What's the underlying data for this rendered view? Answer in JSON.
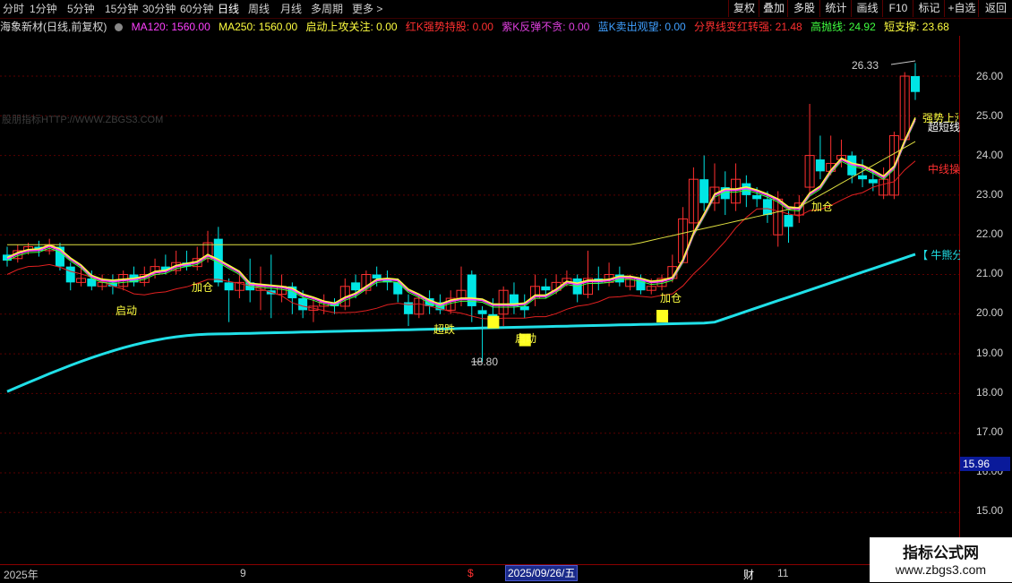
{
  "toolbar": {
    "periods": [
      "分时",
      "1分钟",
      "5分钟",
      "15分钟",
      "30分钟",
      "60分钟",
      "日线",
      "周线",
      "月线",
      "多周期",
      "更多 >"
    ],
    "active_period": "日线",
    "right_buttons": [
      "复权",
      "叠加",
      "多股",
      "统计",
      "画线",
      "F10",
      "标记",
      "+自选",
      "返回"
    ]
  },
  "indicators": {
    "title": "海象新材(日线,前复权)",
    "ma120": "MA120: 1560.00",
    "ma250": "MA250: 1560.00",
    "launch": "启动上攻关注: 0.00",
    "red_k": "红K强势持股: 0.00",
    "purple_k": "紫K反弹不贪: 0.00",
    "blue_k": "蓝K卖出观望: 0.00",
    "boundary": "分界线变红转强: 21.48",
    "high_line": "高抛线: 24.92",
    "short_support": "短支撑: 23.68",
    "colors": {
      "ma120": "#ff40ff",
      "ma250": "#ffff40",
      "launch": "#ffff40",
      "red_k": "#ff3030",
      "purple_k": "#e040e0",
      "blue_k": "#40a0ff",
      "boundary": "#ff3030",
      "high_line": "#40ff40",
      "short_support": "#ffff40"
    }
  },
  "watermark": "股朋指标HTTP://WWW.ZBGS3.COM",
  "axis": {
    "ticks": [
      "26.00",
      "25.00",
      "24.00",
      "23.00",
      "22.00",
      "21.00",
      "20.00",
      "19.00",
      "18.00",
      "17.00",
      "16.00",
      "15.00"
    ],
    "current_price": "15.96"
  },
  "annotations": {
    "high": "26.33",
    "low": "18.80",
    "qidong": "启动",
    "jiacang": "加仓",
    "chaodi": "超跌",
    "strong_up": "强势上涨",
    "short_line": "超短线",
    "mid_line": "中线操",
    "boundary_label": "【 牛熊分界"
  },
  "dates": {
    "year": "2025年",
    "m9": "9",
    "cursor": "2025/09/26/五",
    "m11": "11",
    "s_mark": "$",
    "cai_mark": "财"
  },
  "logo": {
    "line1": "指标公式网",
    "line2": "www.zbgs3.com"
  },
  "chart_data": {
    "type": "candlestick",
    "ylim": [
      14.6,
      26.9
    ],
    "candles": [
      [
        21.5,
        21.35,
        21.7,
        21.2
      ],
      [
        21.4,
        21.6,
        21.75,
        21.3
      ],
      [
        21.6,
        21.7,
        21.8,
        21.5
      ],
      [
        21.7,
        21.6,
        21.85,
        21.45
      ],
      [
        21.6,
        21.75,
        21.9,
        21.5
      ],
      [
        21.7,
        21.2,
        21.8,
        21.1
      ],
      [
        21.2,
        20.8,
        21.3,
        20.6
      ],
      [
        20.8,
        20.9,
        21.2,
        20.7
      ],
      [
        20.9,
        20.7,
        21.1,
        20.6
      ],
      [
        20.7,
        20.8,
        21.0,
        20.6
      ],
      [
        20.8,
        20.7,
        21.0,
        20.5
      ],
      [
        20.7,
        21.0,
        21.1,
        20.6
      ],
      [
        21.0,
        20.8,
        21.2,
        20.7
      ],
      [
        20.8,
        21.0,
        21.2,
        20.7
      ],
      [
        21.0,
        21.2,
        21.4,
        20.9
      ],
      [
        21.2,
        21.1,
        21.5,
        21.0
      ],
      [
        21.1,
        21.3,
        21.6,
        21.0
      ],
      [
        21.3,
        21.2,
        21.6,
        21.1
      ],
      [
        21.2,
        21.4,
        21.7,
        21.1
      ],
      [
        21.4,
        21.8,
        22.1,
        21.3
      ],
      [
        21.9,
        20.8,
        22.2,
        20.7
      ],
      [
        20.8,
        20.6,
        20.9,
        19.8
      ],
      [
        20.6,
        20.8,
        21.0,
        20.4
      ],
      [
        20.8,
        20.6,
        21.4,
        20.3
      ],
      [
        20.6,
        20.7,
        21.2,
        20.1
      ],
      [
        20.6,
        20.5,
        21.5,
        19.9
      ],
      [
        20.5,
        20.7,
        21.0,
        20.3
      ],
      [
        20.7,
        20.4,
        20.8,
        20.0
      ],
      [
        20.4,
        20.1,
        20.6,
        19.9
      ],
      [
        20.1,
        20.2,
        20.4,
        19.8
      ],
      [
        20.2,
        20.3,
        20.5,
        20.0
      ],
      [
        20.3,
        20.2,
        20.4,
        20.0
      ],
      [
        20.2,
        20.7,
        20.9,
        20.1
      ],
      [
        20.8,
        20.6,
        21.0,
        20.4
      ],
      [
        20.6,
        21.0,
        21.1,
        20.5
      ],
      [
        21.0,
        20.9,
        21.2,
        20.7
      ],
      [
        20.9,
        20.8,
        21.1,
        20.6
      ],
      [
        20.8,
        20.5,
        20.9,
        20.3
      ],
      [
        20.3,
        20.0,
        20.5,
        19.7
      ],
      [
        20.0,
        20.4,
        20.5,
        19.9
      ],
      [
        20.4,
        20.2,
        20.6,
        20.0
      ],
      [
        20.3,
        20.1,
        20.5,
        20.0
      ],
      [
        20.1,
        20.4,
        20.6,
        20.0
      ],
      [
        20.4,
        20.6,
        21.2,
        20.2
      ],
      [
        21.0,
        20.2,
        21.1,
        19.8
      ],
      [
        20.1,
        20.0,
        20.2,
        18.8
      ],
      [
        20.0,
        19.9,
        20.4,
        19.7
      ],
      [
        20.0,
        20.6,
        20.7,
        19.7
      ],
      [
        20.5,
        20.2,
        20.8,
        20.0
      ],
      [
        20.2,
        20.1,
        20.5,
        19.9
      ],
      [
        20.4,
        20.7,
        21.0,
        20.2
      ],
      [
        20.7,
        20.6,
        20.9,
        20.4
      ],
      [
        20.6,
        20.8,
        21.0,
        20.5
      ],
      [
        20.8,
        20.9,
        21.1,
        20.7
      ],
      [
        20.9,
        20.5,
        21.0,
        20.3
      ],
      [
        20.5,
        20.9,
        21.6,
        20.4
      ],
      [
        20.9,
        20.8,
        21.2,
        20.6
      ],
      [
        20.8,
        21.0,
        21.3,
        20.7
      ],
      [
        21.0,
        20.8,
        21.2,
        20.7
      ],
      [
        20.7,
        20.9,
        21.0,
        20.6
      ],
      [
        20.9,
        20.6,
        21.0,
        20.5
      ],
      [
        20.6,
        20.7,
        20.9,
        20.5
      ],
      [
        20.7,
        20.9,
        21.0,
        20.6
      ],
      [
        20.9,
        21.2,
        21.5,
        20.8
      ],
      [
        21.3,
        22.4,
        22.7,
        21.3
      ],
      [
        22.3,
        23.4,
        23.7,
        22.1
      ],
      [
        23.4,
        22.8,
        24.0,
        22.6
      ],
      [
        22.8,
        23.2,
        23.8,
        22.6
      ],
      [
        23.2,
        22.9,
        23.6,
        22.5
      ],
      [
        22.8,
        23.4,
        23.8,
        22.6
      ],
      [
        23.3,
        23.0,
        23.5,
        22.7
      ],
      [
        23.0,
        22.9,
        23.2,
        22.7
      ],
      [
        22.9,
        22.5,
        23.1,
        22.3
      ],
      [
        22.0,
        22.9,
        23.1,
        21.7
      ],
      [
        22.5,
        22.2,
        22.6,
        21.8
      ],
      [
        22.5,
        22.8,
        23.0,
        22.3
      ],
      [
        23.2,
        24.0,
        25.3,
        23.0
      ],
      [
        23.9,
        23.6,
        24.5,
        23.4
      ],
      [
        23.6,
        23.8,
        24.5,
        23.5
      ],
      [
        23.9,
        24.0,
        24.4,
        23.7
      ],
      [
        24.0,
        23.5,
        24.1,
        23.3
      ],
      [
        23.5,
        23.4,
        23.9,
        23.2
      ],
      [
        23.4,
        23.3,
        23.6,
        23.1
      ],
      [
        23.0,
        23.4,
        23.7,
        22.9
      ],
      [
        23.0,
        24.5,
        24.6,
        22.9
      ],
      [
        24.4,
        26.0,
        26.1,
        24.3
      ],
      [
        26.0,
        25.6,
        26.33,
        25.4
      ]
    ],
    "up_color": "#ff3030",
    "down_color": "#00e5e5",
    "series": [
      {
        "name": "中线操",
        "color": "#e02020"
      },
      {
        "name": "牛熊分界",
        "color": "#20e0e8"
      },
      {
        "name": "MA120",
        "color": "#ff40ff"
      },
      {
        "name": "MA250",
        "color": "#ffff40"
      },
      {
        "name": "高抛线",
        "color": "#40ff40"
      },
      {
        "name": "短支撑",
        "color": "#ffff40"
      }
    ]
  }
}
